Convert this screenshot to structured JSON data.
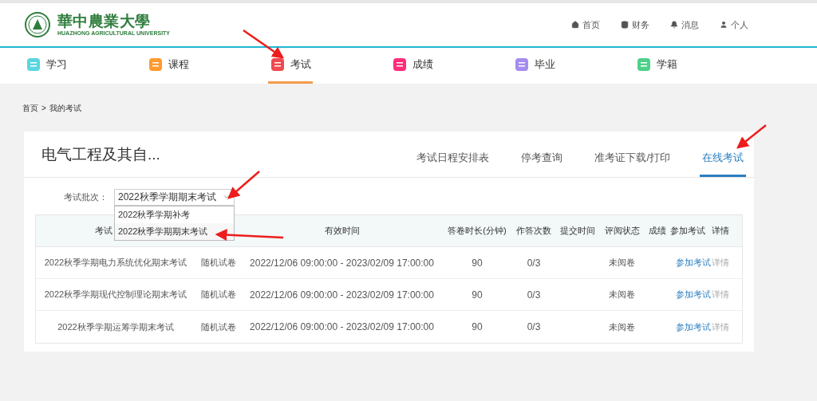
{
  "header": {
    "logo_name": "華中農業大學",
    "logo_subtitle": "HUAZHONG AGRICULTURAL UNIVERSITY",
    "links": [
      {
        "kind": "home",
        "label": "首页"
      },
      {
        "kind": "finance",
        "label": "财务"
      },
      {
        "kind": "message",
        "label": "消息"
      },
      {
        "kind": "user",
        "label": "个人"
      }
    ]
  },
  "nav": [
    {
      "label": "学习",
      "color": "#5bd6e0",
      "selected": false
    },
    {
      "label": "课程",
      "color": "#ff9a2e",
      "selected": false
    },
    {
      "label": "考试",
      "color": "#f04a4f",
      "selected": true
    },
    {
      "label": "成绩",
      "color": "#ff2d7a",
      "selected": false
    },
    {
      "label": "毕业",
      "color": "#a58cf0",
      "selected": false
    },
    {
      "label": "学籍",
      "color": "#4fd08a",
      "selected": false
    }
  ],
  "breadcrumb": [
    "首页",
    ">",
    "我的考试"
  ],
  "card": {
    "title": "电气工程及其自...",
    "tabs": [
      {
        "label": "考试日程安排表",
        "selected": false
      },
      {
        "label": "停考查询",
        "selected": false
      },
      {
        "label": "准考证下载/打印",
        "selected": false
      },
      {
        "label": "在线考试",
        "selected": true
      }
    ],
    "batch": {
      "label": "考试批次：",
      "value": "2022秋季学期期末考试",
      "expanded": true,
      "options": [
        {
          "label": "2022秋季学期补考",
          "selected": false
        },
        {
          "label": "2022秋季学期期末考试",
          "selected": true
        }
      ]
    },
    "table": {
      "columns": [
        "考试",
        "有效时间",
        "答卷时长(分钟)",
        "作答次数",
        "提交时间",
        "评阅状态",
        "成绩",
        "参加考试",
        "详情"
      ],
      "rows": [
        {
          "name": "2022秋季学期电力系统优化期末考试",
          "type": "随机试卷",
          "time": "2022/12/06 09:00:00 - 2023/02/09 17:00:00",
          "duration": "90",
          "attempts": "0/3",
          "status": "未阅卷",
          "join": "参加考试",
          "detail": {
            "label": "详情",
            "disabled": true
          }
        },
        {
          "name": "2022秋季学期现代控制理论期末考试",
          "type": "随机试卷",
          "time": "2022/12/06 09:00:00 - 2023/02/09 17:00:00",
          "duration": "90",
          "attempts": "0/3",
          "status": "未阅卷",
          "join": "参加考试",
          "detail": {
            "label": "详情",
            "disabled": true
          }
        },
        {
          "name": "2022秋季学期运筹学期末考试",
          "type": "随机试卷",
          "time": "2022/12/06 09:00:00 - 2023/02/09 17:00:00",
          "duration": "90",
          "attempts": "0/3",
          "status": "未阅卷",
          "join": "参加考试",
          "detail": {
            "label": "详情",
            "disabled": true
          }
        }
      ]
    }
  }
}
